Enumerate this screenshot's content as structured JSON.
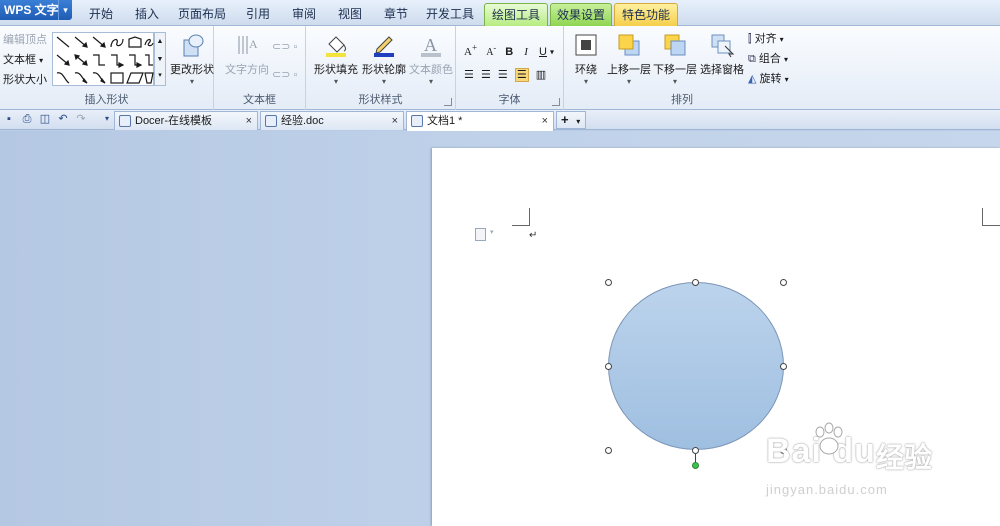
{
  "app": {
    "title": "WPS 文字"
  },
  "menu_tabs": [
    {
      "label": "开始",
      "style": "normal"
    },
    {
      "label": "插入",
      "style": "normal"
    },
    {
      "label": "页面布局",
      "style": "normal"
    },
    {
      "label": "引用",
      "style": "normal"
    },
    {
      "label": "审阅",
      "style": "normal"
    },
    {
      "label": "视图",
      "style": "normal"
    },
    {
      "label": "章节",
      "style": "normal"
    },
    {
      "label": "开发工具",
      "style": "normal"
    },
    {
      "label": "绘图工具",
      "style": "green-active"
    },
    {
      "label": "效果设置",
      "style": "green"
    },
    {
      "label": "特色功能",
      "style": "yellow"
    }
  ],
  "ribbon": {
    "insert_shape": {
      "label": "插入形状",
      "edit_points": "编辑顶点",
      "textbox": "文本框",
      "shape_size": "形状大小",
      "change_shape": "更改形状"
    },
    "textbox_group": {
      "label": "文本框",
      "text_direction": "文字方向"
    },
    "shape_style": {
      "label": "形状样式",
      "fill": "形状填充",
      "outline": "形状轮廓",
      "text_color": "文本颜色"
    },
    "font": {
      "label": "字体"
    },
    "arrange": {
      "label": "排列",
      "wrap": "环绕",
      "bring_forward": "上移一层",
      "send_backward": "下移一层",
      "selection_pane": "选择窗格",
      "align": "对齐",
      "group": "组合",
      "rotate": "旋转"
    }
  },
  "doc_tabs": [
    {
      "title": "Docer-在线模板",
      "close": "×"
    },
    {
      "title": "经验.doc",
      "close": "×"
    },
    {
      "title": "文档1 *",
      "close": "×"
    }
  ],
  "new_tab": "+",
  "paragraph_mark": "↵",
  "watermark": {
    "logo": "Bai du",
    "cn": "经验",
    "url": "jingyan.baidu.com"
  },
  "colors": {
    "accent_blue": "#1f5cb4",
    "drawing_tab_green": "#8fd553",
    "feature_tab_yellow": "#f5cf4a",
    "shape_fill": "#a9c6e6",
    "rotate_handle": "#3fbf4f"
  }
}
